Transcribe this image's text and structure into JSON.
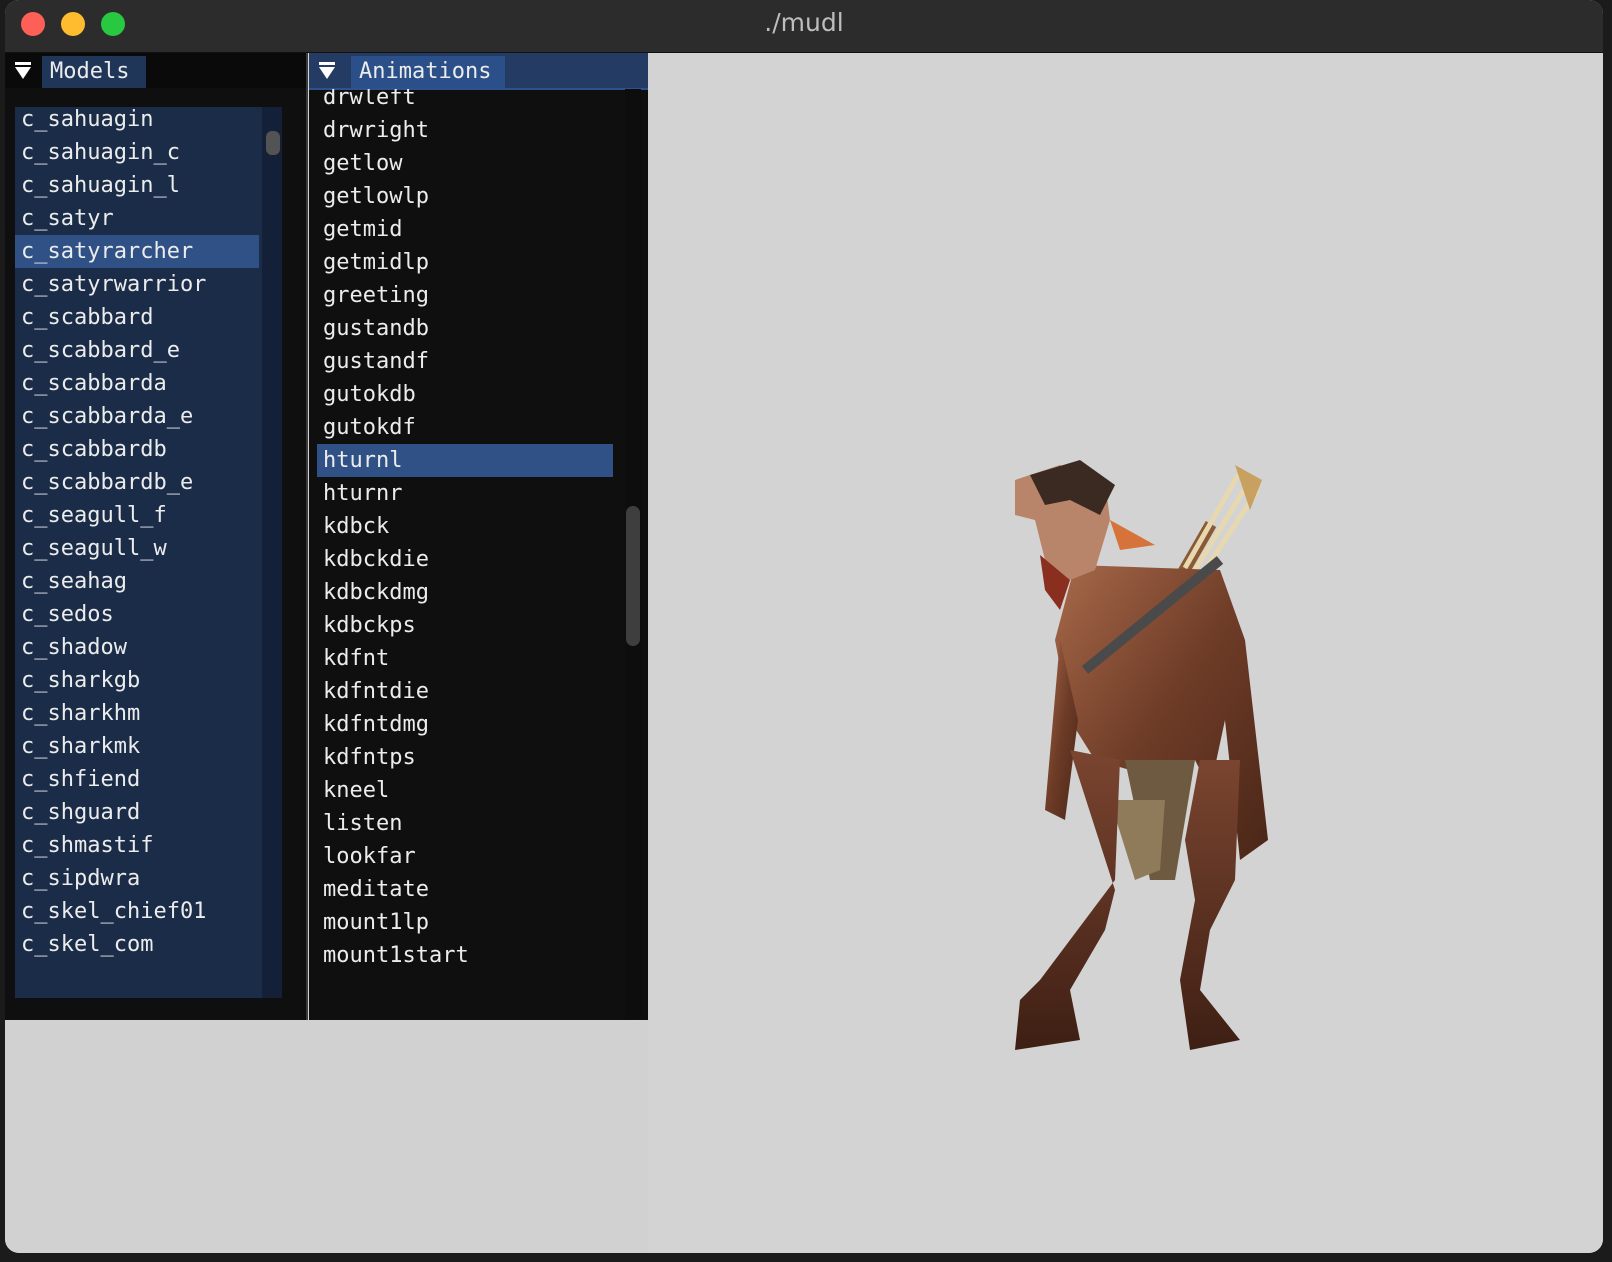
{
  "window": {
    "title": "./mudl"
  },
  "models_panel": {
    "tab_label": "Models",
    "selected_index": 4,
    "items": [
      "c_sahuagin",
      "c_sahuagin_c",
      "c_sahuagin_l",
      "c_satyr",
      "c_satyrarcher",
      "c_satyrwarrior",
      "c_scabbard",
      "c_scabbard_e",
      "c_scabbarda",
      "c_scabbarda_e",
      "c_scabbardb",
      "c_scabbardb_e",
      "c_seagull_f",
      "c_seagull_w",
      "c_seahag",
      "c_sedos",
      "c_shadow",
      "c_sharkgb",
      "c_sharkhm",
      "c_sharkmk",
      "c_shfiend",
      "c_shguard",
      "c_shmastif",
      "c_sipdwra",
      "c_skel_chief01",
      "c_skel_com"
    ]
  },
  "animations_panel": {
    "tab_label": "Animations",
    "selected_index": 11,
    "items": [
      "drwleft",
      "drwright",
      "getlow",
      "getlowlp",
      "getmid",
      "getmidlp",
      "greeting",
      "gustandb",
      "gustandf",
      "gutokdb",
      "gutokdf",
      "hturnl",
      "hturnr",
      "kdbck",
      "kdbckdie",
      "kdbckdmg",
      "kdbckps",
      "kdfnt",
      "kdfntdie",
      "kdfntdmg",
      "kdfntps",
      "kneel",
      "listen",
      "lookfar",
      "meditate",
      "mount1lp",
      "mount1start"
    ]
  },
  "viewport": {
    "subject": "satyr archer model"
  },
  "colors": {
    "traffic_close": "#fe5f57",
    "traffic_minimize": "#febc2e",
    "traffic_zoom": "#28c840",
    "selection": "#2f5186",
    "header_active": "#2b4f88",
    "viewport_bg": "#d3d3d3"
  }
}
